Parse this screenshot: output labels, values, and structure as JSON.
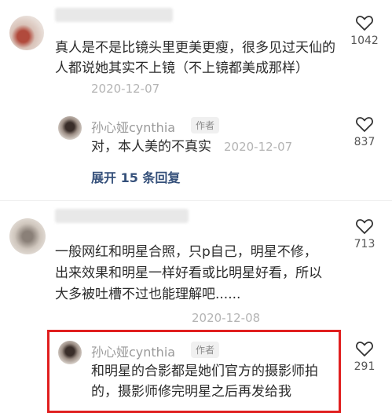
{
  "comments": [
    {
      "text": "真人是不是比镜头里更美更瘦，很多见过天仙的人都说她其实不上镜（不上镜都美成那样）",
      "time": "2020-12-07",
      "likes": "1042",
      "reply": {
        "author": "孙心娅cynthia",
        "badge": "作者",
        "text": "对，本人美的不真实",
        "time": "2020-12-07",
        "likes": "837"
      },
      "expand_label": "展开 15 条回复"
    },
    {
      "text": "一般网红和明星合照，只p自己，明星不修，出来效果和明星一样好看或比明星好看，所以大多被吐槽不过也能理解吧......",
      "time": "2020-12-08",
      "likes": "713",
      "reply": {
        "author": "孙心娅cynthia",
        "badge": "作者",
        "text": "和明星的合影都是她们官方的摄影师拍的，摄影师修完明星之后再发给我",
        "likes": "291"
      }
    }
  ],
  "colors": {
    "highlight": "#e01f1f",
    "link": "#35507a"
  }
}
